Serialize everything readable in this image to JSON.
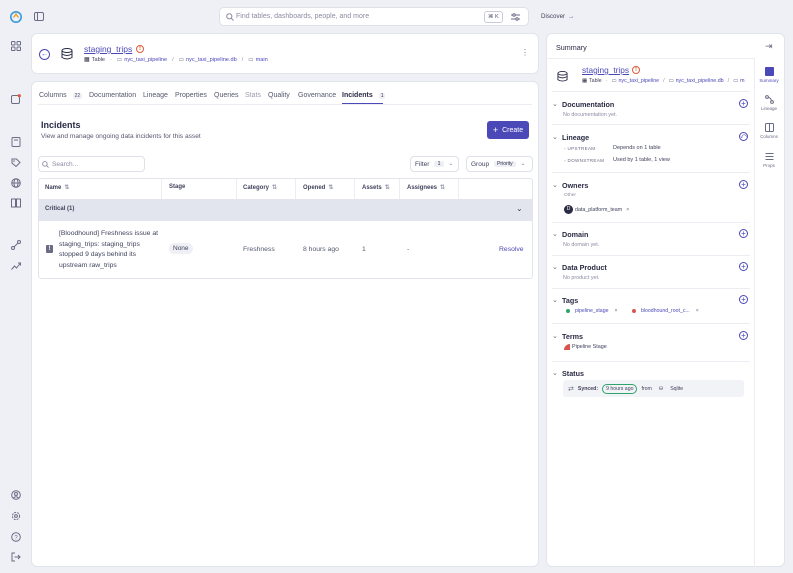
{
  "search": {
    "placeholder": "Find tables, dashboards, people, and more",
    "shortcut": "⌘ K"
  },
  "discover_label": "Discover",
  "entity": {
    "name": "staging_trips",
    "type": "Table",
    "path": [
      "nyc_taxi_pipeline",
      "nyc_taxi_pipeline.db",
      "main"
    ]
  },
  "tabs": [
    {
      "label": "Columns",
      "count": "22"
    },
    {
      "label": "Documentation"
    },
    {
      "label": "Lineage"
    },
    {
      "label": "Properties"
    },
    {
      "label": "Queries"
    },
    {
      "label": "Stats"
    },
    {
      "label": "Quality"
    },
    {
      "label": "Governance"
    },
    {
      "label": "Incidents",
      "count": "1"
    }
  ],
  "incidents": {
    "title": "Incidents",
    "description": "View and manage ongoing data incidents for this asset",
    "create_label": "Create",
    "search_placeholder": "Search...",
    "filter_label": "Filter",
    "filter_count": "1",
    "group_label": "Group",
    "group_value": "Priority",
    "columns": [
      "Name",
      "Stage",
      "Category",
      "Opened",
      "Assets",
      "Assignees"
    ],
    "group_header": "Critical (1)",
    "rows": [
      {
        "priority": "!",
        "name": "[Bloodhound] Freshness issue at staging_trips: staging_trips stopped 9 days behind its upstream raw_trips",
        "stage": "None",
        "category": "Freshness",
        "opened": "8 hours ago",
        "assets": "1",
        "assignees": "-",
        "action": "Resolve"
      }
    ]
  },
  "summary": {
    "header": "Summary",
    "entity_name": "staging_trips",
    "entity_type": "Table",
    "path": [
      "nyc_taxi_pipeline",
      "nyc_taxi_pipeline.db",
      "m"
    ],
    "documentation": {
      "title": "Documentation",
      "empty": "No documentation yet."
    },
    "lineage": {
      "title": "Lineage",
      "upstream_label": "UPSTREAM",
      "upstream_text": "Depends on 1 table",
      "downstream_label": "DOWNSTREAM",
      "downstream_text": "Used by 1 table, 1 view"
    },
    "owners": {
      "title": "Owners",
      "role": "Other",
      "owner": "data_platform_team",
      "avatar": "D"
    },
    "domain": {
      "title": "Domain",
      "empty": "No domain yet."
    },
    "data_product": {
      "title": "Data Product",
      "empty": "No product yet."
    },
    "tags": {
      "title": "Tags",
      "items": [
        "pipeline_stage",
        "bloodhound_root_c..."
      ]
    },
    "terms": {
      "title": "Terms",
      "item": "Pipeline Stage"
    },
    "status": {
      "title": "Status",
      "synced_label": "Synced:",
      "synced_time": "9 hours ago",
      "from_label": "from",
      "source": "Sqlite"
    }
  },
  "right_tabs": [
    "Summary",
    "Lineage",
    "Columns",
    "Props"
  ],
  "colors": {
    "accent": "#4b48b8",
    "warning": "#e05a3a",
    "tag_green": "#2fa36b",
    "tag_red": "#d9534f"
  }
}
